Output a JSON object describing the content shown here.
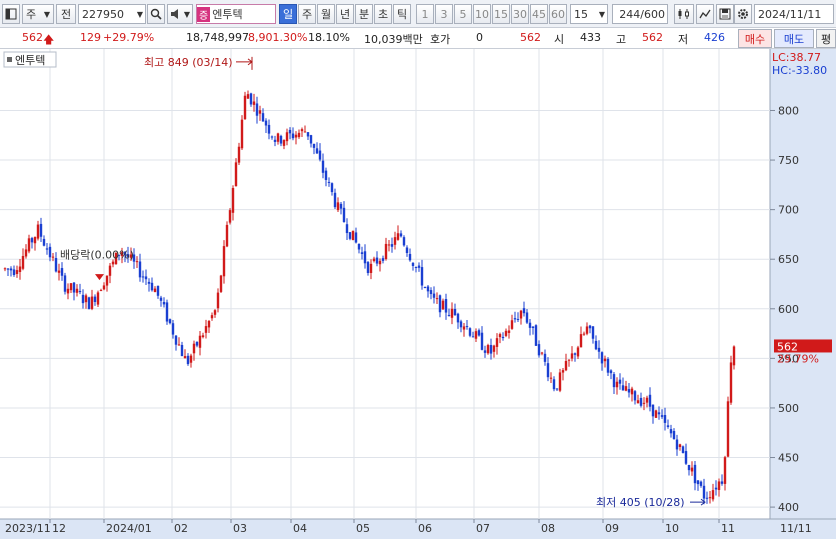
{
  "toolbar": {
    "window_icon": "window-icon",
    "market_label": "주",
    "period_label": "전",
    "stock_code": "227950",
    "search_icon": "search-icon",
    "speaker_icon": "speaker-icon",
    "stock_chip": "증",
    "stock_name": "엔투텍",
    "periods": [
      "일",
      "주",
      "월",
      "년",
      "분",
      "초",
      "틱"
    ],
    "selected_period": "일",
    "numbers": [
      "1",
      "3",
      "5",
      "10",
      "15",
      "30",
      "45",
      "60"
    ],
    "interval_value": "15",
    "count_display": "244",
    "count_max": "/600",
    "date_value": "2024/11/11"
  },
  "quote": {
    "price": "562",
    "change": "129",
    "change_pct": "+29.79%",
    "volume": "18,748,997",
    "volume_pct": "8,901.30%",
    "turnover": "18.10%",
    "amount": "10,039백만",
    "hoga_label": "호가",
    "hoga_value": "0",
    "hoga_price": "562",
    "open_label": "시",
    "open_value": "433",
    "high_label": "고",
    "high_value": "562",
    "low_label": "저",
    "low_value": "426",
    "buy_label": "매수",
    "sell_label": "매도",
    "eval_label": "평"
  },
  "chart_data": {
    "type": "candlestick",
    "series_label": "엔투텍",
    "y_ticks": [
      400,
      450,
      500,
      550,
      600,
      650,
      700,
      750,
      800
    ],
    "ylim": [
      388,
      862
    ],
    "x_ticks": [
      "2023/11",
      "12",
      "2024/01",
      "02",
      "03",
      "04",
      "05",
      "06",
      "07",
      "08",
      "09",
      "10",
      "11",
      "11/11"
    ],
    "lc_label": "LC:38.77",
    "hc_label": "HC:-33.80",
    "annotations": {
      "high": "최고 849 (03/14)",
      "low": "최저 405 (10/28)",
      "dividend": "배당락(0.00%)"
    },
    "current_price": "562",
    "current_change": "29.79%",
    "keypoints": [
      {
        "month": "2023/11",
        "value": 640
      },
      {
        "month": "2023/11",
        "value": 680
      },
      {
        "month": "12",
        "value": 625
      },
      {
        "month": "12",
        "value": 605
      },
      {
        "month": "2024/01",
        "value": 660
      },
      {
        "month": "2024/01",
        "value": 620
      },
      {
        "month": "02",
        "value": 545
      },
      {
        "month": "02",
        "value": 600
      },
      {
        "month": "03",
        "value": 820
      },
      {
        "month": "03",
        "value": 770
      },
      {
        "month": "04",
        "value": 780
      },
      {
        "month": "04",
        "value": 700
      },
      {
        "month": "05",
        "value": 640
      },
      {
        "month": "05",
        "value": 675
      },
      {
        "month": "06",
        "value": 610
      },
      {
        "month": "06",
        "value": 590
      },
      {
        "month": "07",
        "value": 555
      },
      {
        "month": "07",
        "value": 600
      },
      {
        "month": "08",
        "value": 520
      },
      {
        "month": "08",
        "value": 580
      },
      {
        "month": "09",
        "value": 520
      },
      {
        "month": "09",
        "value": 505
      },
      {
        "month": "10",
        "value": 465
      },
      {
        "month": "10",
        "value": 410
      },
      {
        "month": "11",
        "value": 430
      },
      {
        "month": "11",
        "value": 562
      }
    ]
  },
  "colors": {
    "up": "#d11a1a",
    "down": "#1a3fd1",
    "grid": "#dfe3ea",
    "axis_bg": "#dbe5f5",
    "price_tag": "#d11a1a"
  }
}
